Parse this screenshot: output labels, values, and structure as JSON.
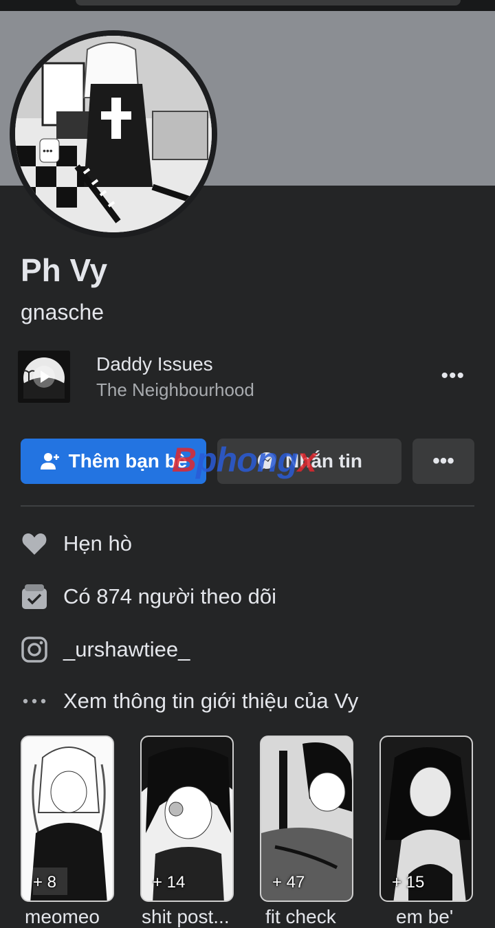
{
  "profile": {
    "name": "Ph Vy",
    "username": "gnasche"
  },
  "music": {
    "title": "Daddy Issues",
    "artist": "The Neighbourhood",
    "more_label": "•••"
  },
  "actions": {
    "add_friend": "Thêm bạn bè",
    "message": "Nhắn tin",
    "more": "•••"
  },
  "watermark": {
    "part1": "B",
    "part2": "phong",
    "part3": "x"
  },
  "info": [
    {
      "icon": "heart-icon",
      "text": "Hẹn hò"
    },
    {
      "icon": "followers-icon",
      "text": "Có 874 người theo dõi"
    },
    {
      "icon": "instagram-icon",
      "text": "_urshawtiee_"
    },
    {
      "icon": "more-dots-icon",
      "text": "Xem thông tin giới thiệu của Vy"
    }
  ],
  "featured": [
    {
      "count": "+ 8",
      "label": "meomeo"
    },
    {
      "count": "+ 14",
      "label": "shit post..."
    },
    {
      "count": "+ 47",
      "label": "fit check"
    },
    {
      "count": "+ 15",
      "label": "em be'"
    }
  ],
  "colors": {
    "background": "#242526",
    "primary_button": "#2374e1",
    "secondary_button": "#3a3b3c",
    "cover": "#8b8e93"
  }
}
